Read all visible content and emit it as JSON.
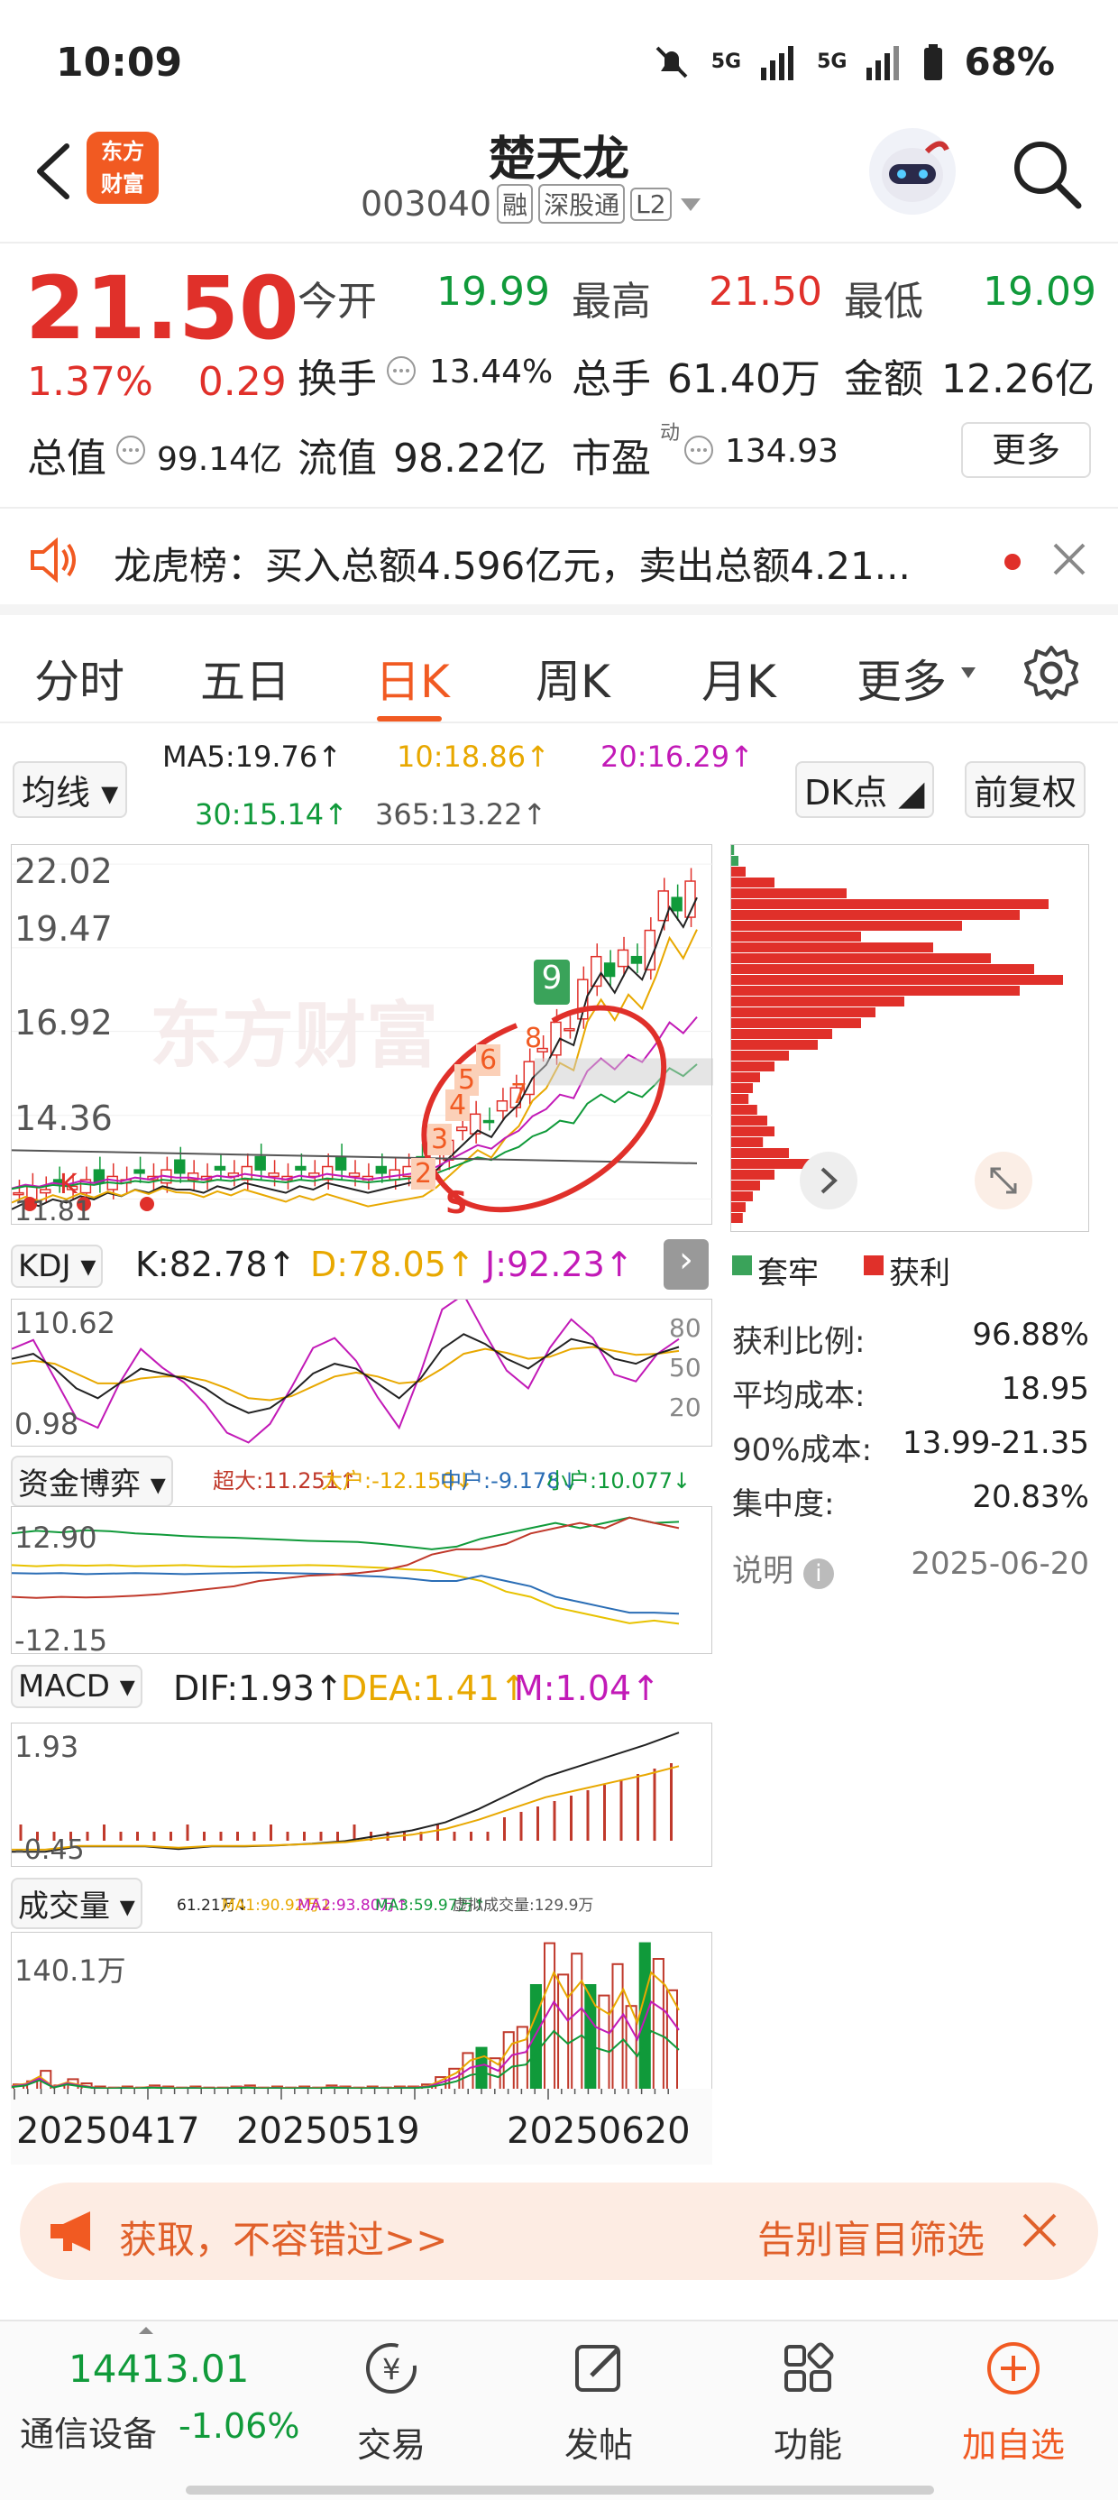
{
  "status": {
    "time": "10:09",
    "signal1": "5G",
    "signal2": "5G",
    "battery": "68%"
  },
  "header": {
    "logo_line1": "东方",
    "logo_line2": "财富",
    "name": "楚天龙",
    "code": "003040",
    "tag1": "融",
    "tag2": "深股通",
    "tag3": "L2"
  },
  "quote": {
    "price": "21.50",
    "change_pct": "1.37%",
    "change": "0.29",
    "open_label": "今开",
    "open": "19.99",
    "high_label": "最高",
    "high": "21.50",
    "low_label": "最低",
    "low": "19.09",
    "turnover_label": "换手",
    "turnover": "13.44%",
    "volume_label": "总手",
    "volume": "61.40万",
    "amount_label": "金额",
    "amount": "12.26亿",
    "mktcap_label": "总值",
    "mktcap": "99.14亿",
    "float_label": "流值",
    "float": "98.22亿",
    "pe_label": "市盈",
    "pe_sup": "动",
    "pe": "134.93",
    "more": "更多"
  },
  "notice": {
    "text": "龙虎榜：买入总额4.596亿元，卖出总额4.21..."
  },
  "tabs": [
    "分时",
    "五日",
    "日K",
    "周K",
    "月K",
    "更多"
  ],
  "ma": {
    "selector": "均线",
    "ma5": "MA5:19.76↑",
    "ma10": "10:18.86↑",
    "ma20": "20:16.29↑",
    "ma30": "30:15.14↑",
    "ma365": "365:13.22↑",
    "dk": "DK点",
    "fq": "前复权"
  },
  "kchart": {
    "y1": "22.02",
    "y2": "19.47",
    "y3": "16.92",
    "y4": "14.36",
    "y5": "11.81",
    "watermark": "东方财富",
    "markers": [
      "9",
      "8",
      "6",
      "7",
      "5",
      "4",
      "3",
      "2",
      "S",
      "K"
    ]
  },
  "chip": {
    "legend_trap": "套牢",
    "legend_profit": "获利",
    "profit_ratio_label": "获利比例:",
    "profit_ratio": "96.88%",
    "avg_cost_label": "平均成本:",
    "avg_cost": "18.95",
    "cost90_label": "90%成本:",
    "cost90": "13.99-21.35",
    "concentration_label": "集中度:",
    "concentration": "20.83%",
    "note_label": "说明",
    "date": "2025-06-20"
  },
  "kdj": {
    "name": "KDJ",
    "k": "K:82.78↑",
    "d": "D:78.05↑",
    "j": "J:92.23↑",
    "ymax": "110.62",
    "ymin": "0.98",
    "l80": "80",
    "l50": "50",
    "l20": "20"
  },
  "funds": {
    "name": "资金博弈",
    "super": "超大:11.251↑",
    "big": "大户:-12.150↓",
    "mid": "中户:-9.178↓",
    "small": "小户:10.077↓",
    "ymax": "12.90",
    "ymin": "-12.15"
  },
  "macd": {
    "name": "MACD",
    "dif": "DIF:1.93↑",
    "dea": "DEA:1.41↑",
    "m": "M:1.04↑",
    "ymax": "1.93",
    "ymin": "-0.45"
  },
  "vol": {
    "name": "成交量",
    "v": "61.21万↓",
    "ma1": "MA1:90.92万↓",
    "ma2": "MA2:93.80万↑",
    "ma3": "MA3:59.97万↑",
    "virtual": "虚拟成交量:129.9万",
    "ymax": "140.1万"
  },
  "dates": [
    "20250417",
    "20250519",
    "20250620"
  ],
  "ad": {
    "text1": "获取，不容错过>>",
    "text2": "告别盲目筛选"
  },
  "bottom": {
    "index_value": "14413.01",
    "index_name": "通信设备",
    "index_change": "-1.06%",
    "trade": "交易",
    "post": "发帖",
    "func": "功能",
    "watch": "加自选"
  }
}
